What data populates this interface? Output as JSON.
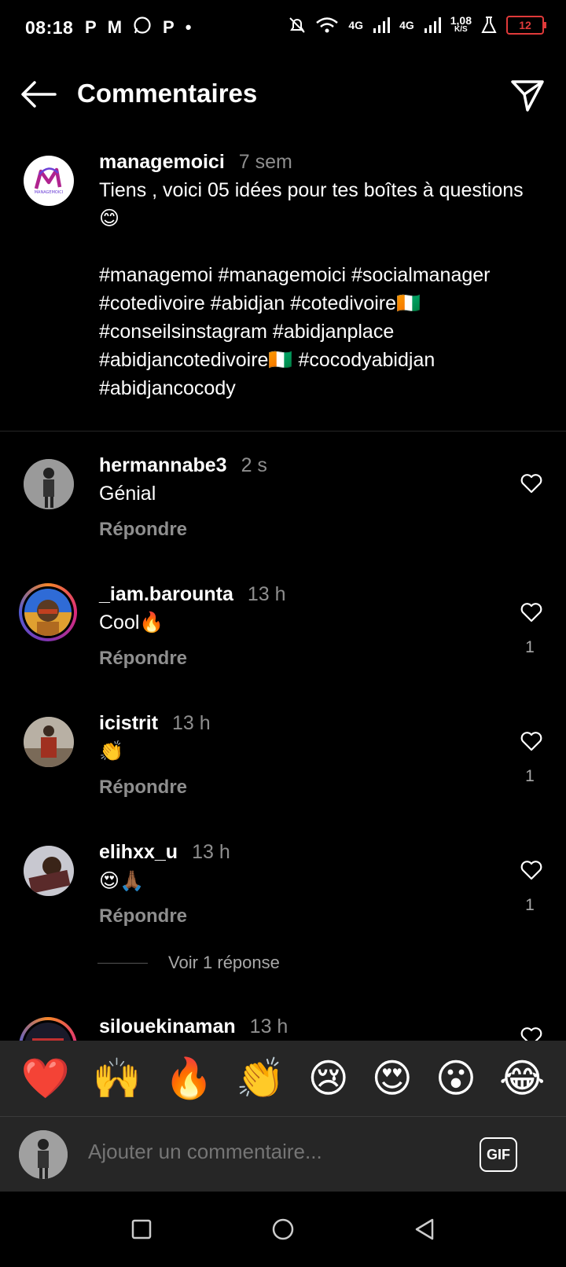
{
  "status": {
    "time": "08:18",
    "left_icons": [
      "P",
      "M",
      "whatsapp-icon",
      "P",
      "•"
    ],
    "net1": "4G",
    "net2": "4G",
    "speed": "1,08",
    "speed_unit": "K/S",
    "battery": "12"
  },
  "header": {
    "title": "Commentaires"
  },
  "caption": {
    "user": "managemoici",
    "time": "7 sem",
    "text": "Tiens , voici 05 idées pour tes boîtes à questions 😊\n\n#managemoi #managemoici #socialmanager #cotedivoire #abidjan #cotedivoire🇨🇮 #conseilsinstagram #abidjanplace #abidjancotedivoire🇨🇮 #cocodyabidjan #abidjancocody",
    "avatar_logo": "MANAGEMOICI"
  },
  "comments": [
    {
      "user": "hermannabe3",
      "time": "2 s",
      "text": "Génial",
      "reply": "Répondre",
      "likes": ""
    },
    {
      "user": "_iam.barounta",
      "time": "13 h",
      "text": "Cool🔥",
      "reply": "Répondre",
      "likes": "1"
    },
    {
      "user": "icistrit",
      "time": "13 h",
      "text": "👏",
      "reply": "Répondre",
      "likes": "1"
    },
    {
      "user": "elihxx_u",
      "time": "13 h",
      "text": "😍🙏🏾",
      "reply": "Répondre",
      "likes": "1"
    },
    {
      "user": "silouekinaman",
      "time": "13 h",
      "text": "",
      "reply": "",
      "likes": ""
    }
  ],
  "view_replies": "Voir 1 réponse",
  "emoji_bar": [
    "❤️",
    "🙌",
    "🔥",
    "👏",
    "😢",
    "😍",
    "😮",
    "😂"
  ],
  "composer": {
    "placeholder": "Ajouter un commentaire...",
    "gif": "GIF"
  }
}
